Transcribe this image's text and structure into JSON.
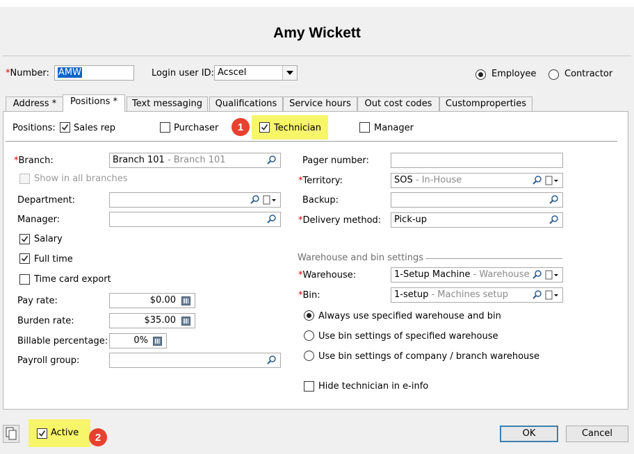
{
  "header": {
    "title": "Amy Wickett"
  },
  "identity": {
    "number_label": "Number:",
    "number_value": "AMW",
    "login_label": "Login user ID:",
    "login_value": "Acscel",
    "employee_label": "Employee",
    "contractor_label": "Contractor",
    "employee_selected": true
  },
  "tabs": [
    {
      "label": "Address *"
    },
    {
      "label": "Positions *",
      "active": true
    },
    {
      "label": "Text messaging"
    },
    {
      "label": "Qualifications"
    },
    {
      "label": "Service hours"
    },
    {
      "label": "Out cost codes"
    },
    {
      "label": "Customproperties"
    }
  ],
  "positions": {
    "label": "Positions:",
    "items": [
      {
        "label": "Sales rep",
        "checked": true
      },
      {
        "label": "Purchaser",
        "checked": false
      },
      {
        "label": "Technician",
        "checked": true,
        "highlighted": true
      },
      {
        "label": "Manager",
        "checked": false
      }
    ]
  },
  "left": {
    "branch_label": "Branch:",
    "branch_value": "Branch 101",
    "branch_hint": " - Branch 101",
    "show_all_branches_label": "Show in all branches",
    "department_label": "Department:",
    "manager_label": "Manager:",
    "salary_label": "Salary",
    "full_time_label": "Full time",
    "time_card_label": "Time card export",
    "pay_rate_label": "Pay rate:",
    "pay_rate_value": "$0.00",
    "burden_rate_label": "Burden rate:",
    "burden_rate_value": "$35.00",
    "billable_label": "Billable percentage:",
    "billable_value": "0%",
    "payroll_label": "Payroll group:"
  },
  "right": {
    "pager_label": "Pager number:",
    "territory_label": "Territory:",
    "territory_value": "SOS",
    "territory_hint": " - In-House",
    "backup_label": "Backup:",
    "delivery_label": "Delivery method:",
    "delivery_value": "Pick-up",
    "warehouse_group_label": "Warehouse and bin settings",
    "warehouse_label": "Warehouse:",
    "warehouse_value": "1-Setup Machine",
    "warehouse_hint": " - Warehouse #",
    "bin_label": "Bin:",
    "bin_value": "1-setup",
    "bin_hint": " - Machines setup",
    "radio_options": [
      {
        "label": "Always use specified warehouse and bin",
        "selected": true
      },
      {
        "label": "Use bin settings of specified warehouse",
        "selected": false
      },
      {
        "label": "Use bin settings of company / branch warehouse",
        "selected": false
      }
    ],
    "hide_tech_label": "Hide technician in e-info"
  },
  "footer": {
    "active_label": "Active",
    "ok_label": "OK",
    "cancel_label": "Cancel"
  },
  "badges": {
    "one": "1",
    "two": "2"
  },
  "colors": {
    "highlight": "#f7f56a",
    "badge": "#e8412f",
    "required": "#e00000",
    "selection": "#0a64c8"
  }
}
